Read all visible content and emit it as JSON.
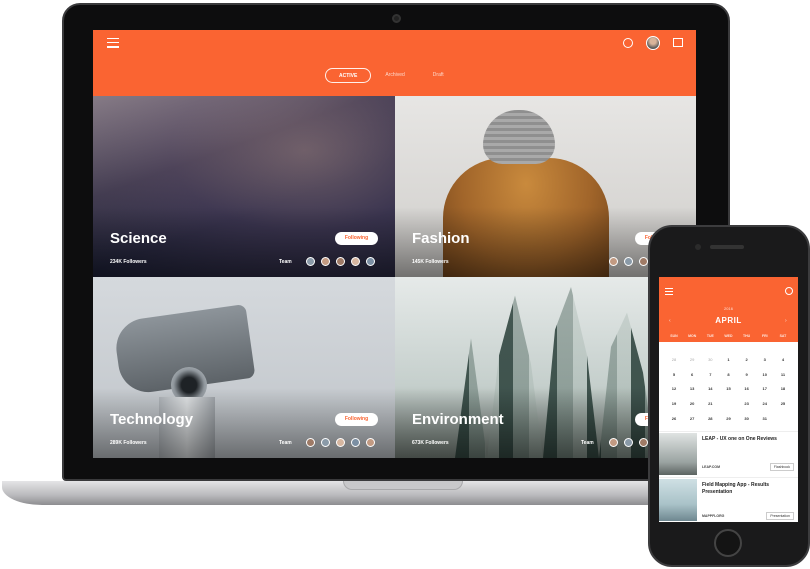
{
  "laptop": {
    "tabs": [
      {
        "label": "ACTIVE",
        "active": true
      },
      {
        "label": "Archived",
        "active": false
      },
      {
        "label": "Draft",
        "active": false
      }
    ],
    "cards": [
      {
        "title": "Science",
        "followers": "234K Followers",
        "team_label": "Team",
        "button": "Following"
      },
      {
        "title": "Fashion",
        "followers": "145K Followers",
        "team_label": "Team",
        "button": "Following"
      },
      {
        "title": "Technology",
        "followers": "289K Followers",
        "team_label": "Team",
        "button": "Following"
      },
      {
        "title": "Environment",
        "followers": "673K Followers",
        "team_label": "Team",
        "button": "Following"
      }
    ],
    "icons": [
      "menu-icon",
      "search-icon",
      "user-avatar",
      "bookmark-icon"
    ]
  },
  "phone": {
    "year": "2016",
    "month": "APRIL",
    "weekdays": [
      "SUN",
      "MON",
      "TUE",
      "WED",
      "THU",
      "FRI",
      "SAT"
    ],
    "weeks": [
      [
        "28",
        "29",
        "30",
        "1",
        "2",
        "3",
        "4"
      ],
      [
        "5",
        "6",
        "7",
        "8",
        "9",
        "10",
        "11"
      ],
      [
        "12",
        "13",
        "14",
        "15",
        "16",
        "17",
        "18"
      ],
      [
        "19",
        "20",
        "21",
        "22",
        "23",
        "24",
        "25"
      ],
      [
        "26",
        "27",
        "28",
        "29",
        "30",
        "31",
        ""
      ]
    ],
    "selected_day": "22",
    "items": [
      {
        "title": "LEAP - UX one on One Reviews",
        "source": "LEAP.COM",
        "tag": "Flashbook"
      },
      {
        "title": "Field Mapping App - Results Presentation",
        "source": "MAPPFLORG",
        "tag": "Presentation"
      }
    ]
  },
  "colors": {
    "accent": "#fa6432"
  }
}
